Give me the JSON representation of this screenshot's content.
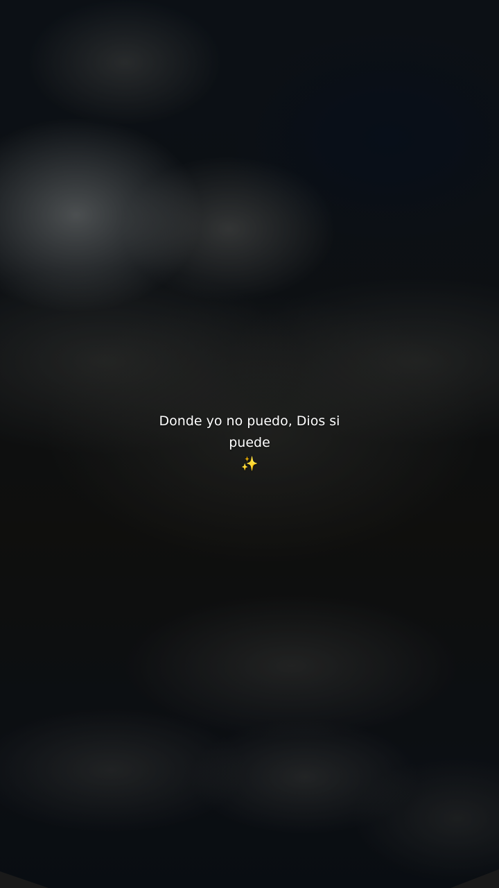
{
  "caption": {
    "line1": "Donde yo no puedo, Dios si",
    "line2": "puede",
    "emoji": "✨"
  }
}
